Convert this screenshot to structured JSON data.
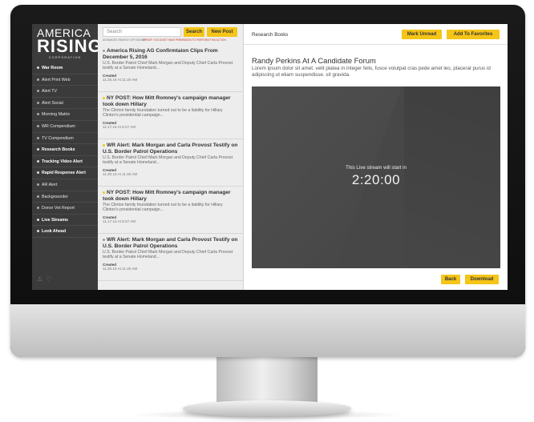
{
  "sidebar": {
    "logo": {
      "line1": "AMERICA",
      "line2": "RISING",
      "line3": "CORPORATION"
    },
    "items": [
      {
        "label": "War Room",
        "bold": true
      },
      {
        "label": "Alert Print Web",
        "bold": false
      },
      {
        "label": "Alert TV",
        "bold": false
      },
      {
        "label": "Alert Social",
        "bold": false
      },
      {
        "label": "Morning Matrix",
        "bold": false
      },
      {
        "label": "WR Compendium",
        "bold": false
      },
      {
        "label": "TV Compendium",
        "bold": false
      },
      {
        "label": "Research Books",
        "bold": true
      },
      {
        "label": "Tracking Video Alert",
        "bold": true
      },
      {
        "label": "Rapid Response Alert",
        "bold": true
      },
      {
        "label": "AR Alert",
        "bold": false
      },
      {
        "label": "Backgrounder",
        "bold": false
      },
      {
        "label": "Donor Vet Report",
        "bold": false
      },
      {
        "label": "Live Streams",
        "bold": true
      },
      {
        "label": "Look Ahead",
        "bold": true
      }
    ],
    "footer_icons": [
      "warning-icon",
      "heart-icon"
    ]
  },
  "search": {
    "placeholder": "Search",
    "search_button": "Search",
    "new_post_button": "New Post",
    "advanced_label": "ADVANCED SEARCH OPTIONS ▾",
    "error_text": "ERROR: YOU DON'T HAVE PERMISSION TO PERFORM THIS ACTION"
  },
  "list": {
    "created_label": "Created",
    "items": [
      {
        "title": "America Rising AG Confirmtaion Clips From December 5, 2016",
        "desc": "U.S. Border Patrol Chief Mark Morgan and Deputy Chief Carla Provost testify at a Senate Homeland...",
        "date": "11.30.16 At 11:20 AM",
        "accent": false
      },
      {
        "title": "NY POST: How Mitt Romney's campaign manager took down Hillary",
        "desc": "The Clinton family foundation turned out to be a liability for Hillary Clinton's presidential campaign...",
        "date": "11.17.16 At 8:27 AM",
        "accent": true
      },
      {
        "title": "WR Alert: Mark Morgan and Carla Provost Testify on U.S. Border Patrol Operations",
        "desc": "U.S. Border Patrol Chief Mark Morgan and Deputy Chief Carla Provost testify at a Senate Homeland...",
        "date": "11.30.16 At 11:20 AM",
        "accent": true
      },
      {
        "title": "NY POST: How Mitt Romney's campaign manager took down Hillary",
        "desc": "The Clinton family foundation turned out to be a liability for Hillary Clinton's presidential campaign...",
        "date": "11.17.16 At 8:27 AM",
        "accent": true
      },
      {
        "title": "WR Alert: Mark Morgan and Carla Provost Testify on U.S. Border Patrol Operations",
        "desc": "U.S. Border Patrol Chief Mark Morgan and Deputy Chief Carla Provost testify at a Senate Homeland...",
        "date": "11.30.16 At 11:20 AM",
        "accent": false
      }
    ]
  },
  "main": {
    "section_label": "Research Books",
    "mark_unread": "Mark Unread",
    "add_favorites": "Add To Favorites",
    "article_title": "Randy Perkins At A Candidate Forum",
    "article_body": "Lorem ipsum dolor sit amet. velit platea in integer felis, fusce volutpat cras pede amet leo, placerat purus id adipiscing ut etiam suspendisse. sit gravida.",
    "stream_text": "This Live stream will start in",
    "countdown": "2:20:00",
    "back_button": "Back",
    "download_button": "Download"
  },
  "colors": {
    "accent": "#f5c518",
    "sidebar": "#3b3b3b",
    "list_bg": "#ededed",
    "video_bg": "#474747"
  }
}
